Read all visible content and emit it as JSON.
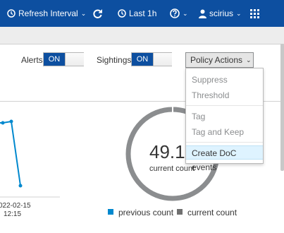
{
  "header": {
    "refresh_label": "Refresh Interval",
    "time_label": "Last 1h",
    "user_label": "scirius"
  },
  "toolbar": {
    "alerts_label": "Alerts",
    "alerts_state": "ON",
    "sightings_label": "Sightings",
    "sightings_state": "ON",
    "policy_actions_label": "Policy Actions"
  },
  "policy_menu": {
    "items": [
      "Suppress",
      "Threshold",
      "Tag",
      "Tag and Keep",
      "Create DoC events"
    ],
    "active_item": "Create DoC events"
  },
  "chart": {
    "x_tick_date": "022-02-15",
    "x_tick_time": "12:15",
    "line_color": "#0088ce"
  },
  "donut": {
    "value": "49.1",
    "caption": "current count",
    "ring_color": "#8b8d8f"
  },
  "legend": {
    "items": [
      {
        "label": "previous count",
        "color": "#0088ce"
      },
      {
        "label": "current count",
        "color": "#707070"
      }
    ]
  }
}
